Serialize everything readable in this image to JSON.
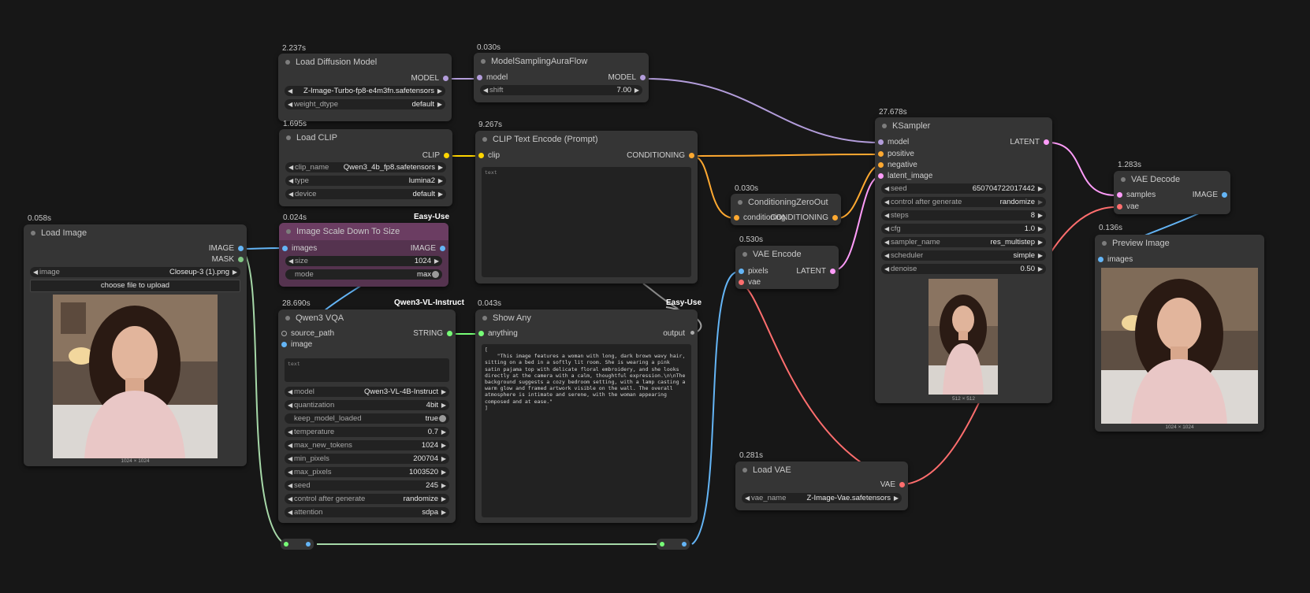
{
  "colors": {
    "model": "#b39ddb",
    "clip": "#ffd500",
    "conditioning": "#ffa931",
    "latent": "#ff9cf9",
    "image": "#64b5f6",
    "vae": "#ff6e6e",
    "string": "#77ff77",
    "mask": "#81c784",
    "anything": "#aaaaaa"
  },
  "nodes": {
    "load_diffusion": {
      "timing": "2.237s",
      "title": "Load Diffusion Model",
      "out_model": "MODEL",
      "unet_name": "Z-Image-Turbo-fp8-e4m3fn.safetensors",
      "weight_label": "weight_dtype",
      "weight_value": "default"
    },
    "model_sampling": {
      "timing": "0.030s",
      "title": "ModelSamplingAuraFlow",
      "in_model": "model",
      "out_model": "MODEL",
      "shift_label": "shift",
      "shift_value": "7.00"
    },
    "load_clip": {
      "timing": "1.695s",
      "title": "Load CLIP",
      "out_clip": "CLIP",
      "clip_name_label": "clip_name",
      "clip_name_value": "Qwen3_4b_fp8.safetensors",
      "type_label": "type",
      "type_value": "lumina2",
      "device_label": "device",
      "device_value": "default"
    },
    "clip_text_encode": {
      "timing": "9.267s",
      "title": "CLIP Text Encode (Prompt)",
      "in_clip": "clip",
      "out_conditioning": "CONDITIONING",
      "text_placeholder": "text"
    },
    "conditioning_zero": {
      "timing": "0.030s",
      "title": "ConditioningZeroOut",
      "in_conditioning": "conditioning",
      "out_conditioning": "CONDITIONING"
    },
    "ksampler": {
      "timing": "27.678s",
      "title": "KSampler",
      "in_model": "model",
      "in_positive": "positive",
      "in_negative": "negative",
      "in_latent": "latent_image",
      "out_latent": "LATENT",
      "seed_label": "seed",
      "seed_value": "650704722017442",
      "cag_label": "control after generate",
      "cag_value": "randomize",
      "steps_label": "steps",
      "steps_value": "8",
      "cfg_label": "cfg",
      "cfg_value": "1.0",
      "sampler_label": "sampler_name",
      "sampler_value": "res_multistep",
      "scheduler_label": "scheduler",
      "scheduler_value": "simple",
      "denoise_label": "denoise",
      "denoise_value": "0.50",
      "dims": "512 × 512"
    },
    "vae_decode": {
      "timing": "1.283s",
      "title": "VAE Decode",
      "in_samples": "samples",
      "in_vae": "vae",
      "out_image": "IMAGE"
    },
    "preview_image": {
      "timing": "0.136s",
      "title": "Preview Image",
      "in_images": "images",
      "dims": "1024 × 1024"
    },
    "load_image": {
      "timing": "0.058s",
      "title": "Load Image",
      "out_image": "IMAGE",
      "out_mask": "MASK",
      "image_label": "image",
      "image_value": "Closeup-3 (1).png",
      "upload_label": "choose file to upload",
      "dims": "1024 × 1024"
    },
    "image_scale": {
      "timing": "0.024s",
      "badge": "Easy-Use",
      "title": "Image Scale Down To Size",
      "in_images": "images",
      "out_image": "IMAGE",
      "size_label": "size",
      "size_value": "1024",
      "mode_label": "mode",
      "mode_value": "max"
    },
    "vae_encode": {
      "timing": "0.530s",
      "title": "VAE Encode",
      "in_pixels": "pixels",
      "in_vae": "vae",
      "out_latent": "LATENT"
    },
    "qwen_vqa": {
      "timing": "28.690s",
      "badge": "Qwen3-VL-Instruct",
      "title": "Qwen3 VQA",
      "in_source": "source_path",
      "in_image": "image",
      "out_string": "STRING",
      "text_placeholder": "text",
      "model_label": "model",
      "model_value": "Qwen3-VL-4B-Instruct",
      "quant_label": "quantization",
      "quant_value": "4bit",
      "keep_label": "keep_model_loaded",
      "keep_value": "true",
      "temp_label": "temperature",
      "temp_value": "0.7",
      "maxtok_label": "max_new_tokens",
      "maxtok_value": "1024",
      "minpix_label": "min_pixels",
      "minpix_value": "200704",
      "maxpix_label": "max_pixels",
      "maxpix_value": "1003520",
      "seed_label": "seed",
      "seed_value": "245",
      "cag_label": "control after generate",
      "cag_value": "randomize",
      "attn_label": "attention",
      "attn_value": "sdpa"
    },
    "show_any": {
      "timing": "0.043s",
      "badge": "Easy-Use",
      "title": "Show Any",
      "in_anything": "anything",
      "out_output": "output",
      "text": "[\n    \"This image features a woman with long, dark brown wavy hair, sitting on a bed in a softly lit room. She is wearing a pink satin pajama top with delicate floral embroidery, and she looks directly at the camera with a calm, thoughtful expression.\\n\\nThe background suggests a cozy bedroom setting, with a lamp casting a warm glow and framed artwork visible on the wall. The overall atmosphere is intimate and serene, with the woman appearing composed and at ease.\"\n]"
    },
    "load_vae": {
      "timing": "0.281s",
      "title": "Load VAE",
      "out_vae": "VAE",
      "vae_label": "vae_name",
      "vae_value": "Z-Image-Vae.safetensors"
    },
    "clip_badge": {
      "badge": "Easy-Use"
    }
  }
}
